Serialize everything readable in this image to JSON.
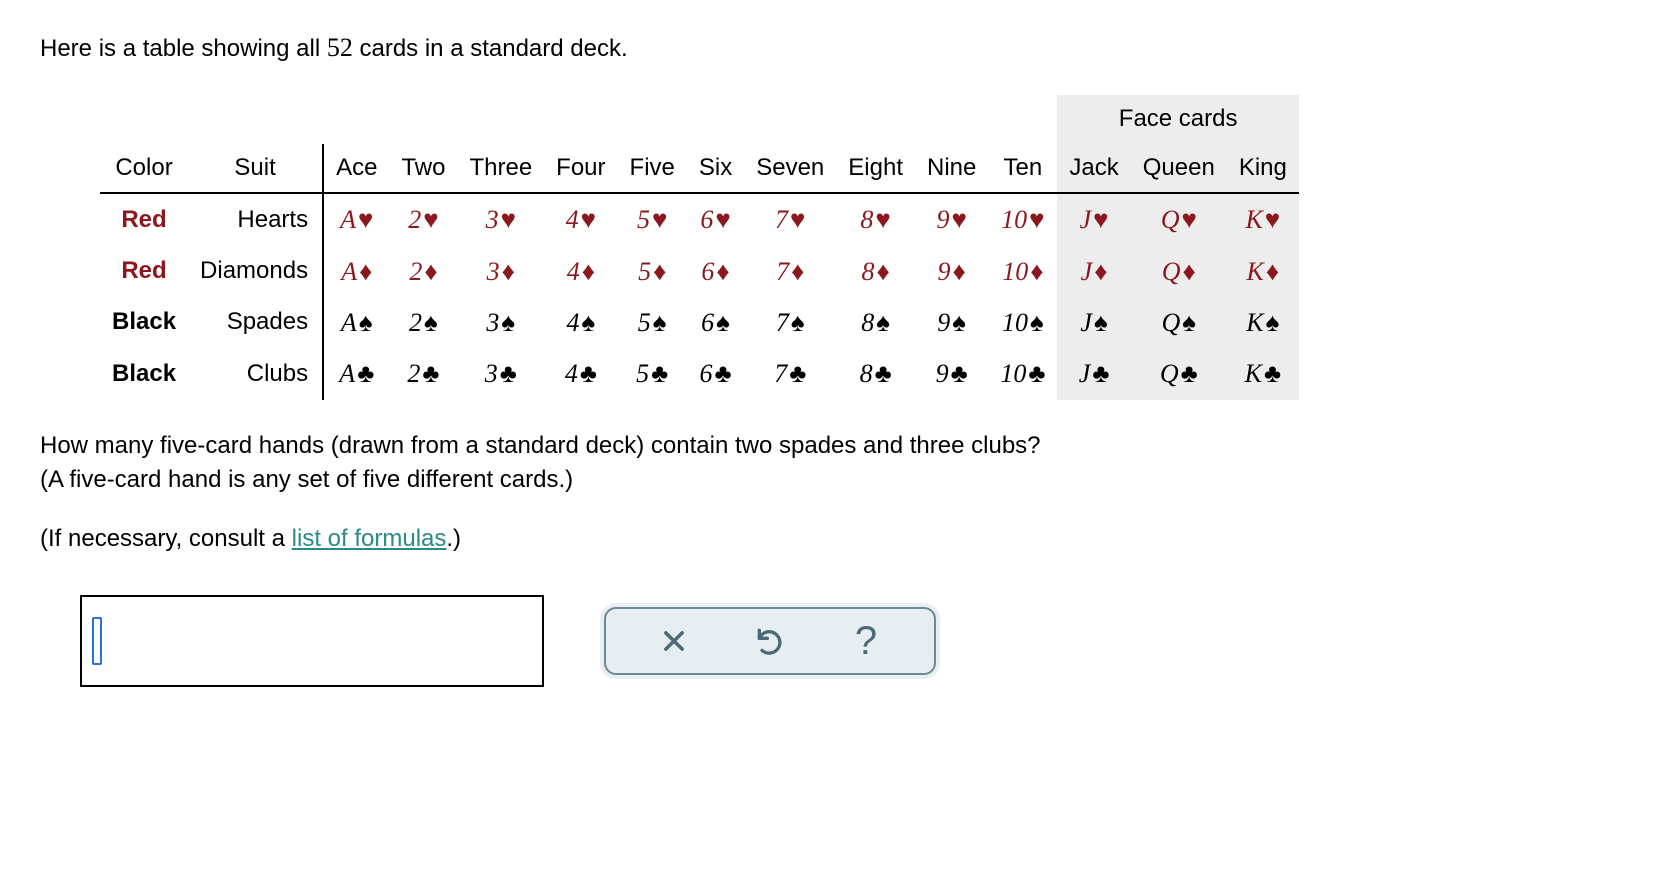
{
  "intro_prefix": "Here is a table showing all ",
  "deck_count": "52",
  "intro_suffix": " cards in a standard deck.",
  "table": {
    "face_header": "Face cards",
    "headers": {
      "color": "Color",
      "suit": "Suit"
    },
    "ranks": [
      {
        "label": "Ace",
        "short": "A",
        "face": false
      },
      {
        "label": "Two",
        "short": "2",
        "face": false
      },
      {
        "label": "Three",
        "short": "3",
        "face": false
      },
      {
        "label": "Four",
        "short": "4",
        "face": false
      },
      {
        "label": "Five",
        "short": "5",
        "face": false
      },
      {
        "label": "Six",
        "short": "6",
        "face": false
      },
      {
        "label": "Seven",
        "short": "7",
        "face": false
      },
      {
        "label": "Eight",
        "short": "8",
        "face": false
      },
      {
        "label": "Nine",
        "short": "9",
        "face": false
      },
      {
        "label": "Ten",
        "short": "10",
        "face": false
      },
      {
        "label": "Jack",
        "short": "J",
        "face": true
      },
      {
        "label": "Queen",
        "short": "Q",
        "face": true
      },
      {
        "label": "King",
        "short": "K",
        "face": true
      }
    ],
    "suits": [
      {
        "color": "Red",
        "name": "Hearts",
        "symbol": "♥",
        "css_color": "red"
      },
      {
        "color": "Red",
        "name": "Diamonds",
        "symbol": "♦",
        "css_color": "red"
      },
      {
        "color": "Black",
        "name": "Spades",
        "symbol": "♠",
        "css_color": "black"
      },
      {
        "color": "Black",
        "name": "Clubs",
        "symbol": "♣",
        "css_color": "black"
      }
    ]
  },
  "question_line1": "How many five-card hands (drawn from a standard deck) contain two spades and three clubs?",
  "question_line2": "(A five-card hand is any set of five different cards.)",
  "hint_prefix": "(If necessary, consult a ",
  "hint_link": "list of formulas",
  "hint_suffix": ".)",
  "answer_value": "",
  "toolbar": {
    "clear": "clear",
    "reset": "reset",
    "help": "help"
  }
}
